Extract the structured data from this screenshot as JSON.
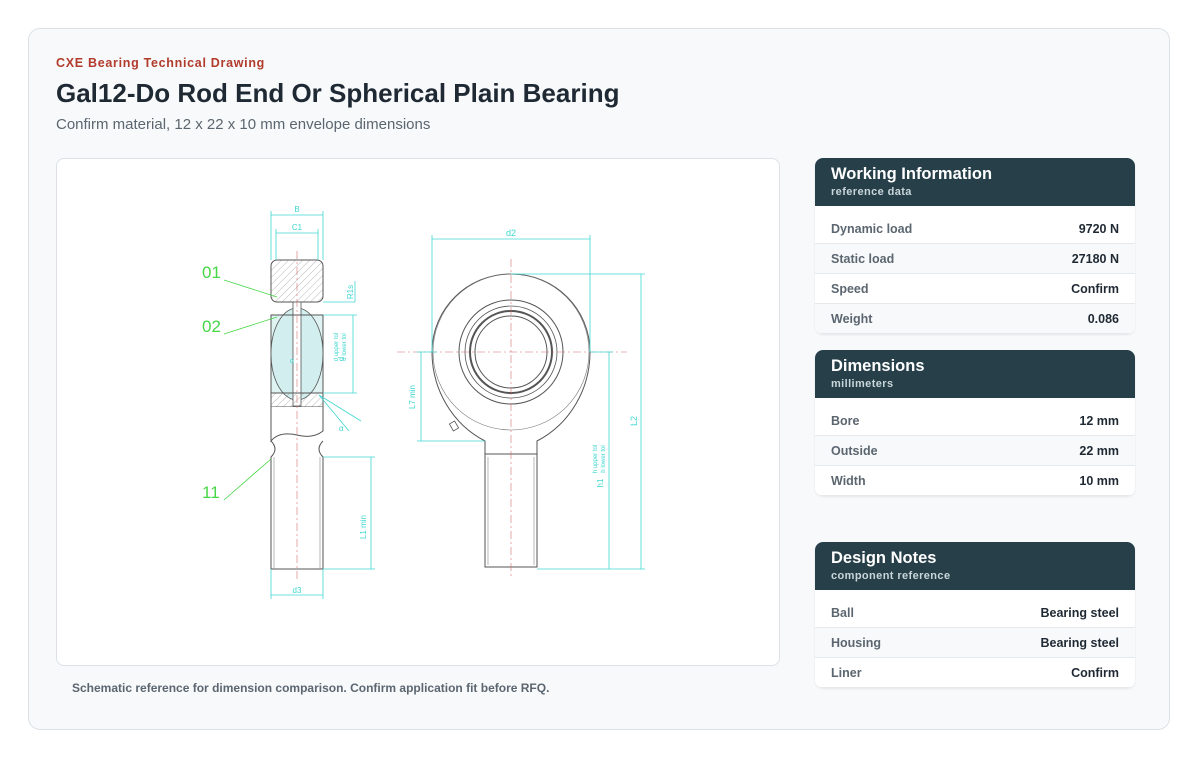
{
  "header": {
    "eyebrow": "CXE Bearing Technical Drawing",
    "title": "Gal12-Do Rod End Or Spherical Plain Bearing",
    "subtitle": "Confirm material, 12 x 22 x 10 mm envelope dimensions"
  },
  "drawing": {
    "callouts": [
      "01",
      "02",
      "11"
    ],
    "labels": {
      "B": "B",
      "C1": "C1",
      "d2": "d2",
      "d3": "d3",
      "L2": "L2",
      "R1s": "R1s",
      "L7": "L7 min",
      "L1": "L1 min",
      "d_upper": "d upper tol",
      "d_lower": "d lower tol",
      "h_upper": "h upper tol",
      "h_lower": "h lower tol",
      "alpha": "α",
      "d_sym": "d",
      "h1_sym": "h1"
    },
    "colors": {
      "dimension": "#3fd6d0",
      "callout": "#46d646",
      "outline": "#555555",
      "center": "#d07070"
    }
  },
  "caption": "Schematic reference for dimension comparison. Confirm application fit before RFQ.",
  "cards": {
    "working": {
      "title": "Working Information",
      "subtitle": "reference data",
      "rows": [
        {
          "label": "Dynamic load",
          "value": "9720 N"
        },
        {
          "label": "Static load",
          "value": "27180 N"
        },
        {
          "label": "Speed",
          "value": "Confirm"
        },
        {
          "label": "Weight",
          "value": "0.086"
        }
      ]
    },
    "dimensions": {
      "title": "Dimensions",
      "subtitle": "millimeters",
      "rows": [
        {
          "label": "Bore",
          "value": "12 mm"
        },
        {
          "label": "Outside",
          "value": "22 mm"
        },
        {
          "label": "Width",
          "value": "10 mm"
        }
      ]
    },
    "design": {
      "title": "Design Notes",
      "subtitle": "component reference",
      "rows": [
        {
          "label": "Ball",
          "value": "Bearing steel"
        },
        {
          "label": "Housing",
          "value": "Bearing steel"
        },
        {
          "label": "Liner",
          "value": "Confirm"
        }
      ]
    }
  }
}
